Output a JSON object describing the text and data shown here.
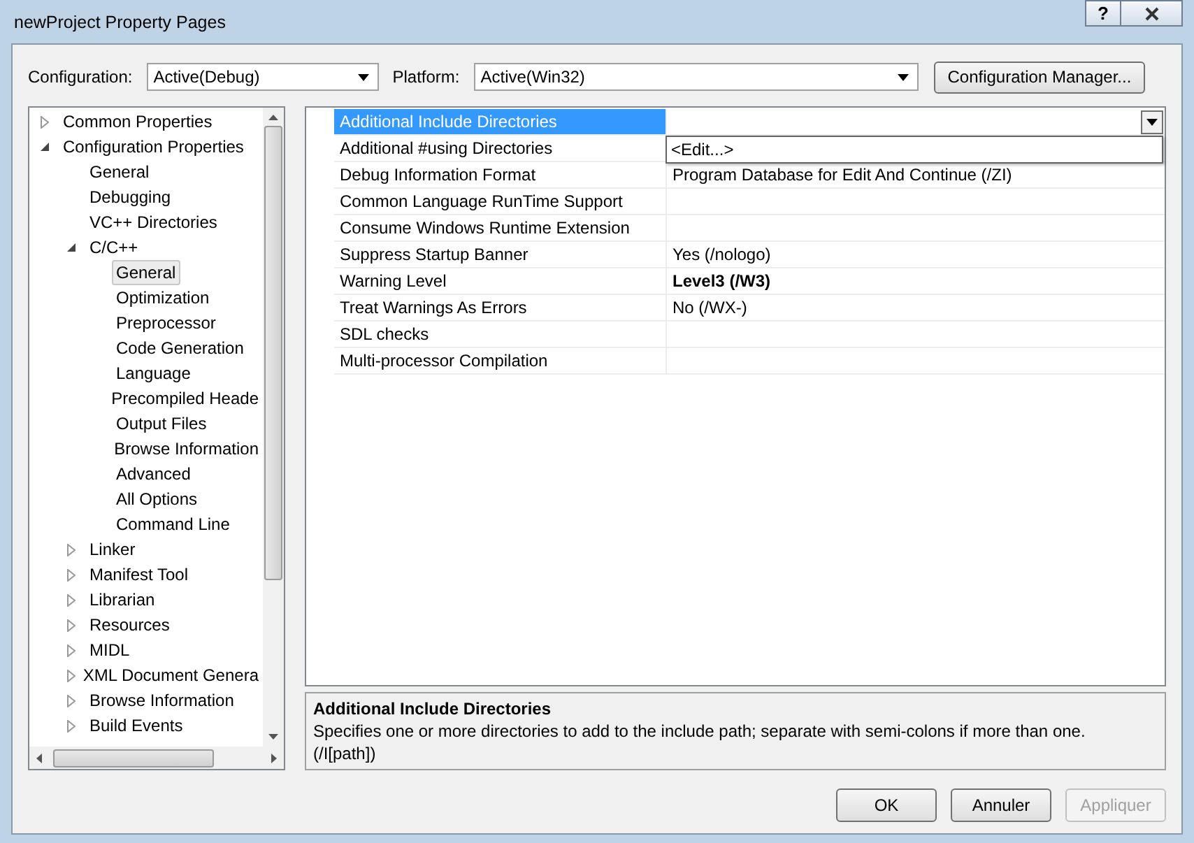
{
  "window": {
    "title": "newProject Property Pages",
    "help_button": "?"
  },
  "toolbar": {
    "configuration_label": "Configuration:",
    "configuration": "Active(Debug)",
    "platform_label": "Platform:",
    "platform": "Active(Win32)",
    "manager_button": "Configuration Manager..."
  },
  "tree": [
    {
      "label": "Common Properties",
      "expanded": false,
      "selected": false
    },
    {
      "label": "Configuration Properties",
      "expanded": true,
      "selected": false,
      "children": [
        {
          "label": "General",
          "selected": false
        },
        {
          "label": "Debugging",
          "selected": false
        },
        {
          "label": "VC++ Directories",
          "selected": false
        },
        {
          "label": "C/C++",
          "expanded": true,
          "selected": false,
          "children": [
            {
              "label": "General",
              "selected": true
            },
            {
              "label": "Optimization",
              "selected": false
            },
            {
              "label": "Preprocessor",
              "selected": false
            },
            {
              "label": "Code Generation",
              "selected": false
            },
            {
              "label": "Language",
              "selected": false
            },
            {
              "label": "Precompiled Heade",
              "selected": false
            },
            {
              "label": "Output Files",
              "selected": false
            },
            {
              "label": "Browse Information",
              "selected": false
            },
            {
              "label": "Advanced",
              "selected": false
            },
            {
              "label": "All Options",
              "selected": false
            },
            {
              "label": "Command Line",
              "selected": false
            }
          ]
        },
        {
          "label": "Linker",
          "expanded": false,
          "selected": false
        },
        {
          "label": "Manifest Tool",
          "expanded": false,
          "selected": false
        },
        {
          "label": "Librarian",
          "expanded": false,
          "selected": false
        },
        {
          "label": "Resources",
          "expanded": false,
          "selected": false
        },
        {
          "label": "MIDL",
          "expanded": false,
          "selected": false
        },
        {
          "label": "XML Document Genera",
          "expanded": false,
          "selected": false
        },
        {
          "label": "Browse Information",
          "expanded": false,
          "selected": false
        },
        {
          "label": "Build Events",
          "expanded": false,
          "selected": false
        }
      ]
    }
  ],
  "properties": [
    {
      "name": "Additional Include Directories",
      "selected": true
    },
    {
      "name": "Additional #using Directories",
      "selected": false
    },
    {
      "name": "Debug Information Format",
      "value": "Program Database for Edit And Continue (/ZI)",
      "selected": false,
      "bold": false
    },
    {
      "name": "Common Language RunTime Support",
      "selected": false
    },
    {
      "name": "Consume Windows Runtime Extension",
      "selected": false
    },
    {
      "name": "Suppress Startup Banner",
      "value": "Yes (/nologo)",
      "selected": false,
      "bold": false
    },
    {
      "name": "Warning Level",
      "value": "Level3 (/W3)",
      "selected": false,
      "bold": true
    },
    {
      "name": "Treat Warnings As Errors",
      "value": "No (/WX-)",
      "selected": false,
      "bold": false
    },
    {
      "name": "SDL checks",
      "selected": false
    },
    {
      "name": "Multi-processor Compilation",
      "selected": false
    }
  ],
  "dropdown": {
    "options": [
      "<Edit...>"
    ]
  },
  "description": {
    "title": "Additional Include Directories",
    "text": "Specifies one or more directories to add to the include path; separate with semi-colons if more than one.",
    "switch": "(/I[path])"
  },
  "buttons": [
    {
      "label": "OK",
      "disabled": false
    },
    {
      "label": "Annuler",
      "disabled": false
    },
    {
      "label": "Appliquer",
      "disabled": true
    }
  ]
}
